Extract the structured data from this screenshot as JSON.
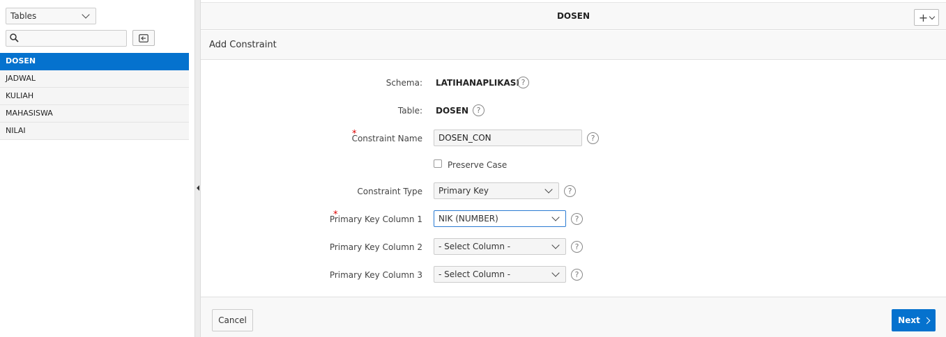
{
  "sidebar": {
    "object_type": "Tables",
    "search": {
      "value": "",
      "placeholder": ""
    },
    "items": [
      {
        "label": "DOSEN",
        "active": true
      },
      {
        "label": "JADWAL",
        "active": false
      },
      {
        "label": "KULIAH",
        "active": false
      },
      {
        "label": "MAHASISWA",
        "active": false
      },
      {
        "label": "NILAI",
        "active": false
      }
    ]
  },
  "header": {
    "title": "DOSEN",
    "add_label": "+"
  },
  "dialog": {
    "title": "Add Constraint",
    "schema": {
      "label": "Schema:",
      "value": "LATIHANAPLIKASI"
    },
    "table": {
      "label": "Table:",
      "value": "DOSEN"
    },
    "constraint_name": {
      "label": "Constraint Name",
      "value": "DOSEN_CON",
      "required": true
    },
    "preserve_case": {
      "label": "Preserve Case",
      "checked": false
    },
    "constraint_type": {
      "label": "Constraint Type",
      "value": "Primary Key"
    },
    "pk_col_1": {
      "label": "Primary Key Column 1",
      "value": "NIK (NUMBER)",
      "required": true
    },
    "pk_col_2": {
      "label": "Primary Key Column 2",
      "value": "- Select Column -"
    },
    "pk_col_3": {
      "label": "Primary Key Column 3",
      "value": "- Select Column -"
    },
    "help_glyph": "?",
    "required_glyph": "*"
  },
  "footer": {
    "cancel_label": "Cancel",
    "next_label": "Next"
  },
  "colors": {
    "accent": "#0572ce",
    "required": "#dd0000"
  }
}
